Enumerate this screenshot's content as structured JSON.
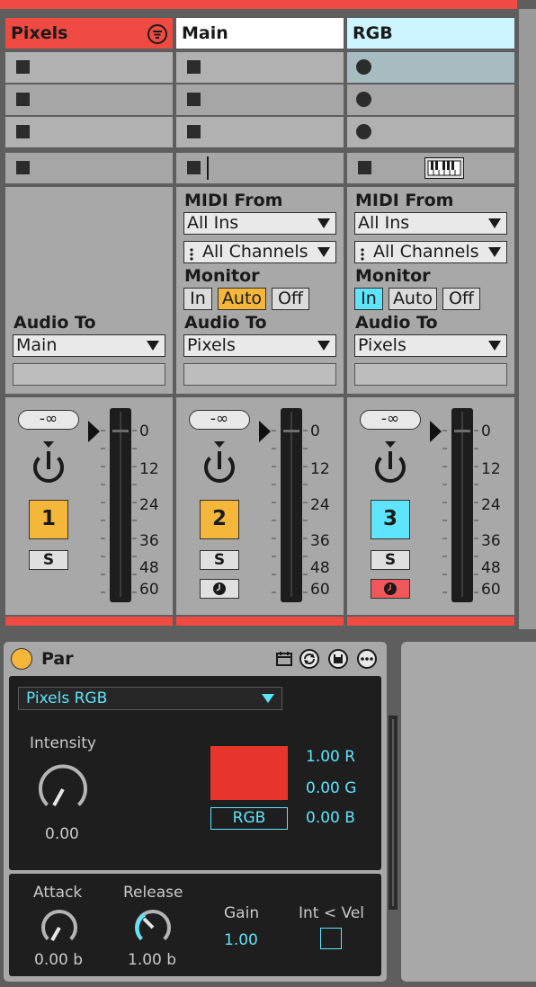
{
  "tracks": [
    {
      "name": "Pixels",
      "number": "1",
      "color": "#ef4b42",
      "number_bg": "#f5b73a"
    },
    {
      "name": "Main",
      "number": "2",
      "color": "#ffffff",
      "number_bg": "#f5b73a"
    },
    {
      "name": "RGB",
      "number": "3",
      "color": "#ccf5ff",
      "number_bg": "#5ee4fb"
    }
  ],
  "routing": {
    "midi_from_label": "MIDI From",
    "midi_from_value": "All Ins",
    "channels_value": "All Channels",
    "monitor_label": "Monitor",
    "monitor_in": "In",
    "monitor_auto": "Auto",
    "monitor_off": "Off",
    "audio_to_label": "Audio To",
    "audio_to_values": [
      "Main",
      "Pixels",
      "Pixels"
    ]
  },
  "mixer": {
    "volume": "-∞",
    "solo": "S",
    "db_scale": [
      "0",
      "12",
      "24",
      "36",
      "48",
      "60"
    ]
  },
  "device": {
    "name": "Par",
    "preset": "Pixels RGB",
    "intensity_label": "Intensity",
    "intensity_value": "0.00",
    "color_swatch": "#e8352b",
    "rgb_button": "RGB",
    "r_value": "1.00 R",
    "g_value": "0.00 G",
    "b_value": "0.00 B",
    "attack_label": "Attack",
    "attack_value": "0.00 b",
    "release_label": "Release",
    "release_value": "1.00 b",
    "gain_label": "Gain",
    "gain_value": "1.00",
    "int_vel_label": "Int < Vel"
  },
  "colors": {
    "accent": "#5ee4fb",
    "orange": "#f5b73a",
    "red_track": "#ef4b42",
    "arm_red": "#f0575a"
  }
}
